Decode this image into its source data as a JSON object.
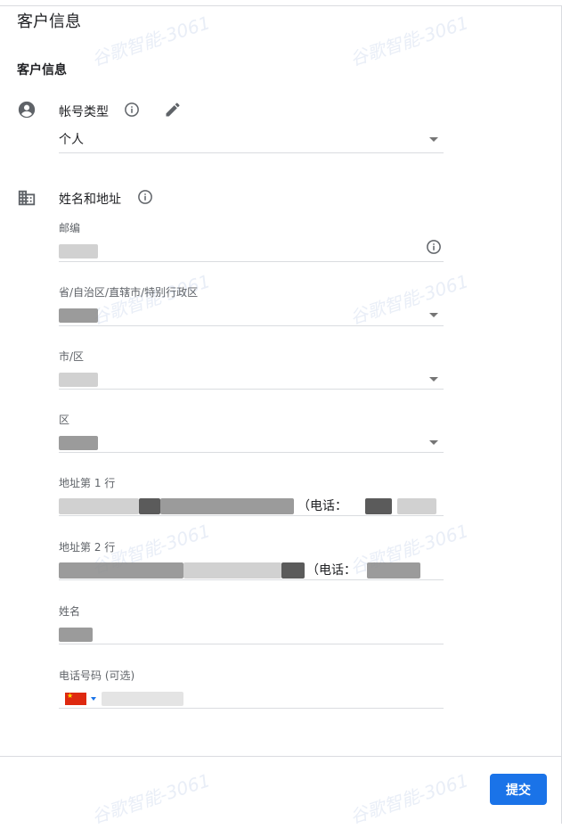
{
  "page": {
    "title": "客户信息"
  },
  "section": {
    "title": "客户信息"
  },
  "account_type": {
    "label": "帐号类型",
    "value": "个人"
  },
  "name_address": {
    "label": "姓名和地址",
    "fields": {
      "postal_code": {
        "label": "邮编"
      },
      "province": {
        "label": "省/自治区/直辖市/特别行政区"
      },
      "city": {
        "label": "市/区"
      },
      "district": {
        "label": "区"
      },
      "address_line1": {
        "label": "地址第 1 行",
        "visible_text": "（电话："
      },
      "address_line2": {
        "label": "地址第 2 行",
        "visible_text": "（电话："
      },
      "name": {
        "label": "姓名"
      },
      "phone": {
        "label": "电话号码 (可选)"
      }
    }
  },
  "watermark": {
    "text": "谷歌智能-3061"
  },
  "footer": {
    "submit_label": "提交"
  },
  "colors": {
    "accent": "#1a73e8",
    "text": "#202124",
    "secondary_text": "#5f6368",
    "divider": "#dadce0",
    "icon": "#5f6368"
  },
  "icons": {
    "person": "account-circle-icon",
    "info": "info-outline-icon",
    "edit": "pencil-icon",
    "building": "business-icon",
    "flag": "china-flag-icon"
  }
}
